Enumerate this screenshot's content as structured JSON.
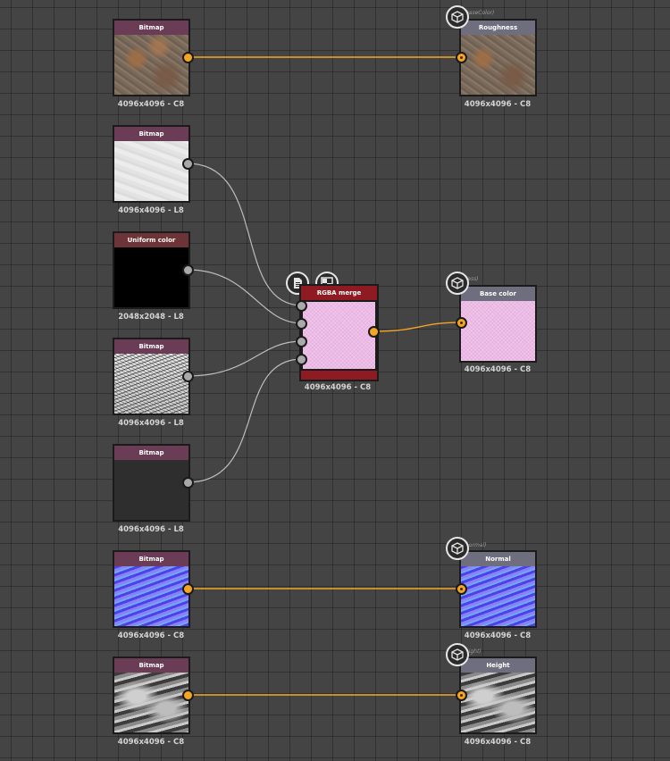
{
  "nodes": [
    {
      "id": "bitmap-1",
      "title": "Bitmap",
      "caption": "4096x4096 - C8"
    },
    {
      "id": "bitmap-2",
      "title": "Bitmap",
      "caption": "4096x4096 - L8"
    },
    {
      "id": "uniform-color",
      "title": "Uniform color",
      "caption": "2048x2048 - L8"
    },
    {
      "id": "bitmap-3",
      "title": "Bitmap",
      "caption": "4096x4096 - L8"
    },
    {
      "id": "bitmap-4",
      "title": "Bitmap",
      "caption": "4096x4096 - L8"
    },
    {
      "id": "bitmap-5",
      "title": "Bitmap",
      "caption": "4096x4096 - C8"
    },
    {
      "id": "bitmap-6",
      "title": "Bitmap",
      "caption": "4096x4096 - C8"
    },
    {
      "id": "rgba-merge",
      "title": "RGBA merge",
      "caption": "4096x4096 - C8"
    },
    {
      "id": "out-roughness",
      "title": "Roughness",
      "caption": "4096x4096 - C8",
      "ghost": "baseColor)"
    },
    {
      "id": "out-basecolor",
      "title": "Base color",
      "caption": "4096x4096 - C8",
      "ghost": "(ess)"
    },
    {
      "id": "out-normal",
      "title": "Normal",
      "caption": "4096x4096 - C8",
      "ghost": "normal)"
    },
    {
      "id": "out-height",
      "title": "Height",
      "caption": "4096x4096 - C8",
      "ghost": "eight)"
    }
  ],
  "colors": {
    "canvas": "#444444",
    "bitmap_header": "#6a3c55",
    "uniform_header": "#6d3438",
    "output_header": "#6e6e7e",
    "merge_header": "#8f1b22",
    "wire_color": "#f5a524",
    "wire_gray": "#bdbdbd"
  },
  "icons": {
    "output_badge": "cube-icon",
    "merge_badge_left": "document-icon",
    "merge_badge_right": "checker-icon"
  }
}
